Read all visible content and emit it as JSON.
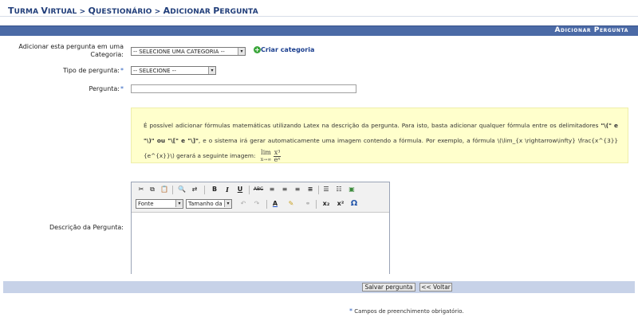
{
  "breadcrumb": {
    "part1_initial": "T",
    "part1_rest": "URMA ",
    "part2_initial": "V",
    "part2_rest": "IRTUAL",
    "sep": " > ",
    "part3_initial": "Q",
    "part3_rest": "UESTIONÁRIO",
    "part4_initial": "A",
    "part4_rest": "DICIONAR ",
    "part5_initial": "P",
    "part5_rest": "ERGUNTA"
  },
  "header": {
    "title": "Adicionar Pergunta"
  },
  "form": {
    "category_label_line1": "Adicionar esta pergunta em uma",
    "category_label_line2": "Categoria:",
    "category_select": "-- SELECIONE UMA CATEGORIA --",
    "create_category_link": "Criar categoria",
    "type_label": "Tipo de pergunta:",
    "type_select": "-- SELECIONE --",
    "question_label": "Pergunta:",
    "question_value": "",
    "description_label": "Descrição da Pergunta:"
  },
  "info": {
    "text_part1": "É possível adicionar fórmulas matemáticas utilizando Latex na descrição da pergunta. Para isto, basta adicionar qualquer fórmula entre os delimitadores ",
    "delims": "\"\\(\" e \"\\)\" ou \"\\[\" e \"\\]\"",
    "text_part2": ", e o sistema irá gerar automaticamente uma imagem contendo a fórmula. Por exemplo, a fórmula \\(\\lim_{x \\rightarrow\\infty} \\frac{x^{3}}{e^{x}}\\) gerará a seguinte imagem:",
    "formula_lim": "lim",
    "formula_sub": "x→∞",
    "formula_num": "x³",
    "formula_den": "eˣ"
  },
  "editor": {
    "font_select": "Fonte",
    "size_select": "Tamanho da F",
    "bold": "B",
    "italic": "I",
    "underline": "U",
    "strike": "ABC",
    "subscript": "x₂",
    "superscript": "x²",
    "omega": "Ω",
    "color_a": "A"
  },
  "buttons": {
    "save": "Salvar pergunta",
    "back": "<< Voltar"
  },
  "required_note": "Campos de preenchimento obrigatório.",
  "required_star": "*",
  "colors": {
    "header_bg": "#4b6aa6",
    "footer_bg": "#c7d2e8",
    "info_bg": "#ffffcc",
    "link": "#1b3f8f",
    "star": "#2a5fbf"
  }
}
